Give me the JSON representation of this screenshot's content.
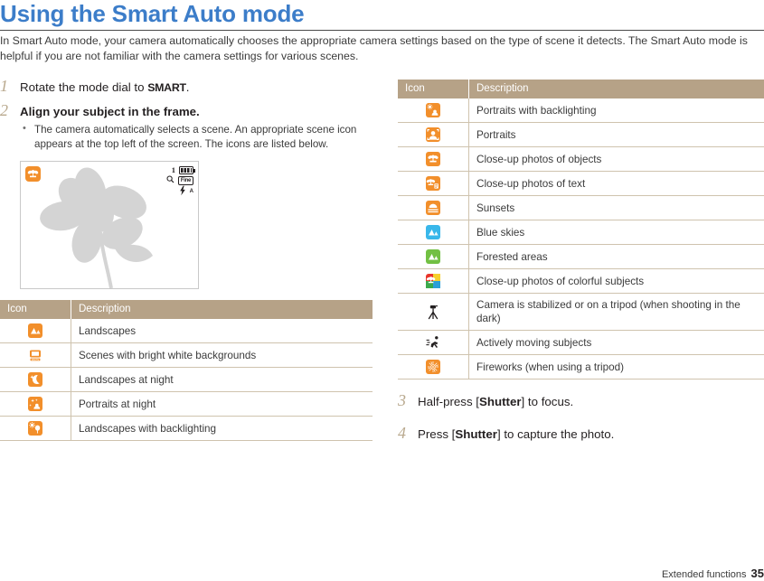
{
  "page": {
    "title": "Using the Smart Auto mode",
    "intro": "In Smart Auto mode, your camera automatically chooses the appropriate camera settings based on the type of scene it detects. The Smart Auto mode is helpful if you are not familiar with the camera settings for various scenes.",
    "accent_blue": "#3c7dc9",
    "table_header_tan": "#b6a287",
    "step_number_color": "#b9a98e",
    "icon_orange": "#f28f2b"
  },
  "steps_left": [
    {
      "number": "1",
      "text_before": "Rotate the mode dial to ",
      "bold_word": "SMART",
      "text_after": "."
    },
    {
      "number": "2",
      "text_before": "Align your subject in the frame.",
      "bold_word": "",
      "text_after": "",
      "bullets": [
        "The camera automatically selects a scene. An appropriate scene icon appears at the top left of the screen. The icons are listed below."
      ]
    }
  ],
  "steps_right": [
    {
      "number": "3",
      "text_before": "Half-press [",
      "bold_word": "Shutter",
      "text_after": "] to focus."
    },
    {
      "number": "4",
      "text_before": "Press [",
      "bold_word": "Shutter",
      "text_after": "] to capture the photo."
    }
  ],
  "camera_screen": {
    "scene_icon": "macro-flower-icon",
    "shots_remaining": "1",
    "battery_icon": "battery-full-icon",
    "zoom_icon": "magnifier-icon",
    "quality_label": "Fine",
    "flash_icon": "flash-auto-icon",
    "flash_label": "A"
  },
  "table_left": {
    "headers": [
      "Icon",
      "Description"
    ],
    "rows": [
      {
        "icon": "landscape-orange-icon",
        "description": "Landscapes"
      },
      {
        "icon": "white-background-icon",
        "description": "Scenes with bright white backgrounds"
      },
      {
        "icon": "night-landscape-icon",
        "description": "Landscapes at night"
      },
      {
        "icon": "night-portrait-icon",
        "description": "Portraits at night"
      },
      {
        "icon": "backlight-landscape-icon",
        "description": "Landscapes with backlighting"
      }
    ]
  },
  "table_right": {
    "headers": [
      "Icon",
      "Description"
    ],
    "rows": [
      {
        "icon": "backlight-portrait-icon",
        "description": "Portraits with backlighting"
      },
      {
        "icon": "portrait-icon",
        "description": "Portraits"
      },
      {
        "icon": "macro-object-icon",
        "description": "Close-up photos of objects"
      },
      {
        "icon": "macro-text-icon",
        "description": "Close-up photos of text"
      },
      {
        "icon": "sunset-icon",
        "description": "Sunsets"
      },
      {
        "icon": "blue-sky-icon",
        "description": "Blue skies"
      },
      {
        "icon": "forest-icon",
        "description": "Forested areas"
      },
      {
        "icon": "macro-color-icon",
        "description": "Close-up photos of colorful subjects"
      },
      {
        "icon": "tripod-icon",
        "description": "Camera is stabilized or on a tripod (when shooting in the dark)"
      },
      {
        "icon": "action-icon",
        "description": "Actively moving subjects"
      },
      {
        "icon": "fireworks-icon",
        "description": "Fireworks (when using a tripod)"
      }
    ]
  },
  "footer": {
    "section": "Extended functions",
    "page_number": "35"
  }
}
